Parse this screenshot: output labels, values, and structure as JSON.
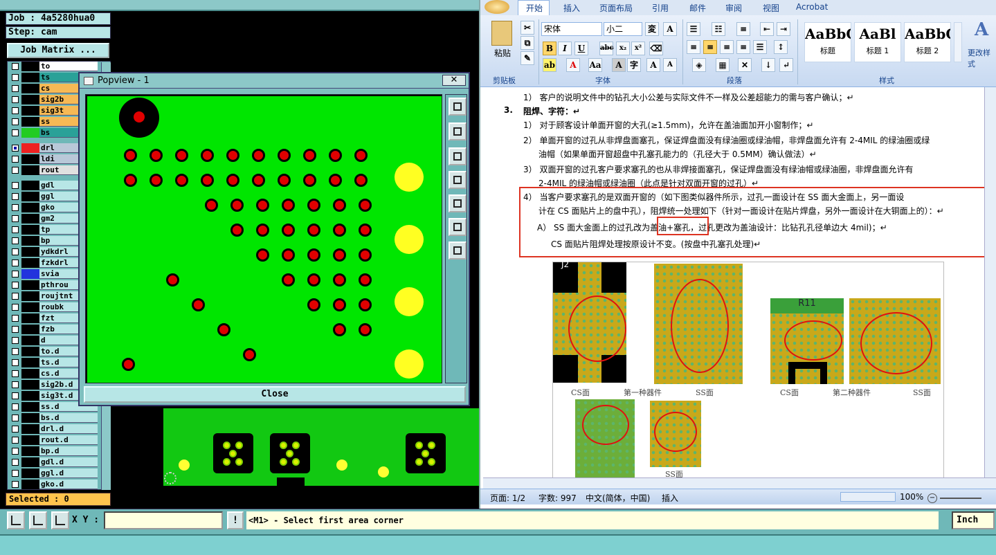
{
  "cam": {
    "job": "Job : 4a5280hua0",
    "step": "Step: cam",
    "job_matrix": "Job Matrix ...",
    "selected": "Selected : 0",
    "layers": [
      {
        "name": "to",
        "color": "#ffffff"
      },
      {
        "name": "ts",
        "color": "#2aa198"
      },
      {
        "name": "cs",
        "color": "#f7b955"
      },
      {
        "name": "sig2b",
        "color": "#f7b955"
      },
      {
        "name": "sig3t",
        "color": "#f7b955"
      },
      {
        "name": "ss",
        "color": "#f7b955"
      },
      {
        "name": "bs",
        "color": "#2aa198"
      },
      {
        "name": "drl",
        "color": "#b9c8d8"
      },
      {
        "name": "ldi",
        "color": "#b9c8d8"
      },
      {
        "name": "rout",
        "color": "#e0e0e0"
      },
      {
        "name": "gdl",
        "color": "#b7e6e6"
      },
      {
        "name": "ggl",
        "color": "#b7e6e6"
      },
      {
        "name": "gko",
        "color": "#b7e6e6"
      },
      {
        "name": "gm2",
        "color": "#b7e6e6"
      },
      {
        "name": "tp",
        "color": "#b7e6e6"
      },
      {
        "name": "bp",
        "color": "#b7e6e6"
      },
      {
        "name": "ydkdrl",
        "color": "#b7e6e6"
      },
      {
        "name": "fzkdrl",
        "color": "#b7e6e6"
      },
      {
        "name": "svia",
        "color": "#b7e6e6"
      },
      {
        "name": "pthrou",
        "color": "#b7e6e6"
      },
      {
        "name": "roujtnt",
        "color": "#b7e6e6"
      },
      {
        "name": "roubk",
        "color": "#b7e6e6"
      },
      {
        "name": "fzt",
        "color": "#b7e6e6"
      },
      {
        "name": "fzb",
        "color": "#b7e6e6"
      },
      {
        "name": "d",
        "color": "#b7e6e6"
      },
      {
        "name": "to.d",
        "color": "#b7e6e6"
      },
      {
        "name": "ts.d",
        "color": "#b7e6e6"
      },
      {
        "name": "cs.d",
        "color": "#b7e6e6"
      },
      {
        "name": "sig2b.d",
        "color": "#b7e6e6"
      },
      {
        "name": "sig3t.d",
        "color": "#b7e6e6"
      },
      {
        "name": "ss.d",
        "color": "#b7e6e6"
      },
      {
        "name": "bs.d",
        "color": "#b7e6e6"
      },
      {
        "name": "drl.d",
        "color": "#b7e6e6"
      },
      {
        "name": "rout.d",
        "color": "#b7e6e6"
      },
      {
        "name": "bp.d",
        "color": "#b7e6e6"
      },
      {
        "name": "gdl.d",
        "color": "#b7e6e6"
      },
      {
        "name": "ggl.d",
        "color": "#b7e6e6"
      },
      {
        "name": "gko.d",
        "color": "#b7e6e6"
      }
    ]
  },
  "popview": {
    "title": "Popview - 1",
    "close_label": "Close",
    "close_x": "✕"
  },
  "status": {
    "xy_label": "X Y :",
    "xy_value": "",
    "bang": "!",
    "message": "<M1> - Select first area corner",
    "units": "Inch"
  },
  "word": {
    "tabs": [
      "开始",
      "插入",
      "页面布局",
      "引用",
      "邮件",
      "审阅",
      "视图",
      "Acrobat"
    ],
    "font_name": "宋体",
    "font_size": "小二",
    "groups": [
      "剪贴板",
      "字体",
      "段落",
      "样式"
    ],
    "paste_label": "粘贴",
    "styles": [
      {
        "sample": "AaBbC",
        "name": "标题"
      },
      {
        "sample": "AaBl",
        "name": "标题 1"
      },
      {
        "sample": "AaBbC",
        "name": "标题 2"
      }
    ],
    "change_style": "更改样式",
    "doc": {
      "line0": "1） 客户的说明文件中的钻孔大小公差与实际文件不一样及公差超能力的需与客户确认；↵",
      "heading_num": "3.",
      "heading": "阻焊、字符：↵",
      "p1": "1） 对于顾客设计单面开窗的大孔(≥1.5mm)，允许在盖油面加开小窗制作；↵",
      "p2a": "2） 单面开窗的过孔从非焊盘面塞孔，保证焊盘面没有绿油圈或绿油帽，非焊盘面允许有 2-4MIL 的绿油圈或绿",
      "p2b": "油帽（如果单面开窗超盘中孔塞孔能力的（孔径大于 0.5MM）确认做法）↵",
      "p3a": "3） 双面开窗的过孔客户要求塞孔的也从非焊接面塞孔，保证焊盘面没有绿油帽或绿油圈，非焊盘面允许有",
      "p3b": "2-4MIL 的绿油帽或绿油圈（此点是针对双面开窗的过孔）↵",
      "p4a": "4）  当客户要求塞孔的是双面开窗的（如下图类似器件所示，过孔一面设计在 SS 面大金面上，另一面设",
      "p4b": "计在 CS 面贴片上的盘中孔），阻焊统一处理如下（针对一面设计在贴片焊盘，另外一面设计在大铜面上的）：↵",
      "p4c": "A） SS 面大金面上的过孔改为盖油+塞孔，过孔更改为盖油设计：比钻孔孔径单边大 4mil)；↵",
      "p4d": "CS 面贴片阻焊处理按原设计不变。(按盘中孔塞孔处理)↵"
    },
    "figure": {
      "r11": "R11",
      "j2": "J2",
      "cap_cs1": "CS面",
      "cap_dev1": "第一种器件",
      "cap_ss1": "SS面",
      "cap_cs2": "CS面",
      "cap_dev2": "第二种器件",
      "cap_ss2": "SS面",
      "cap_ss3": "SS面"
    },
    "statusbar": {
      "page": "页面: 1/2",
      "words": "字数: 997",
      "lang": "中文(简体，中国)",
      "mode": "插入",
      "zoom": "100%"
    }
  }
}
